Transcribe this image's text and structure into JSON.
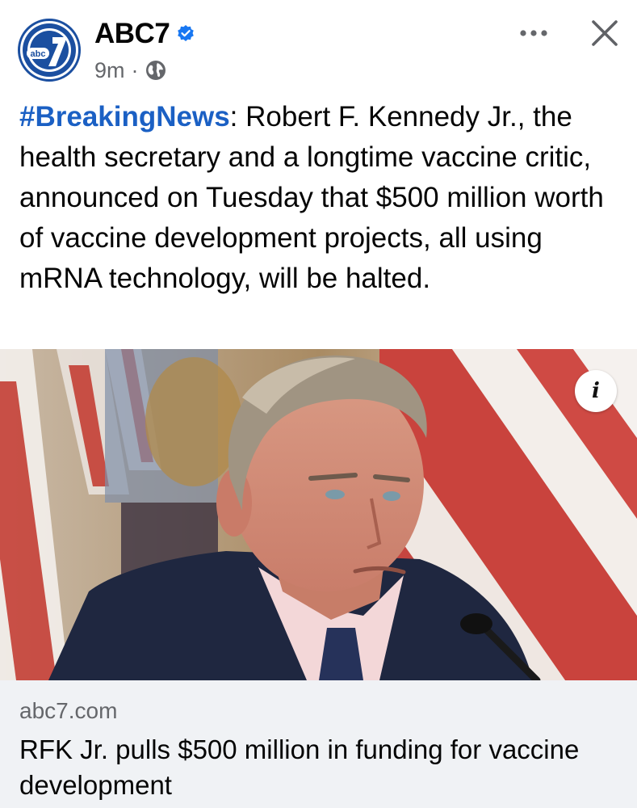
{
  "header": {
    "page_name": "ABC7",
    "time_ago": "9m",
    "separator": "·",
    "avatar_text": "abc"
  },
  "post": {
    "hashtag": "#BreakingNews",
    "body": ": Robert F. Kennedy Jr., the health secretary and a longtime vaccine critic, announced on Tuesday that $500 million worth of vaccine development projects, all using mRNA technology, will be halted."
  },
  "link": {
    "domain": "abc7.com",
    "title": "RFK Jr. pulls $500 million in funding for vaccine development",
    "info_label": "i"
  },
  "icons": {
    "verified": "verified-badge-icon",
    "globe": "globe-icon",
    "more": "more-horizontal-icon",
    "close": "close-icon",
    "info": "info-icon"
  },
  "colors": {
    "accent": "#1b60c4",
    "verified": "#1877f2",
    "footer_bg": "#f0f2f5",
    "meta_text": "#65676b"
  }
}
